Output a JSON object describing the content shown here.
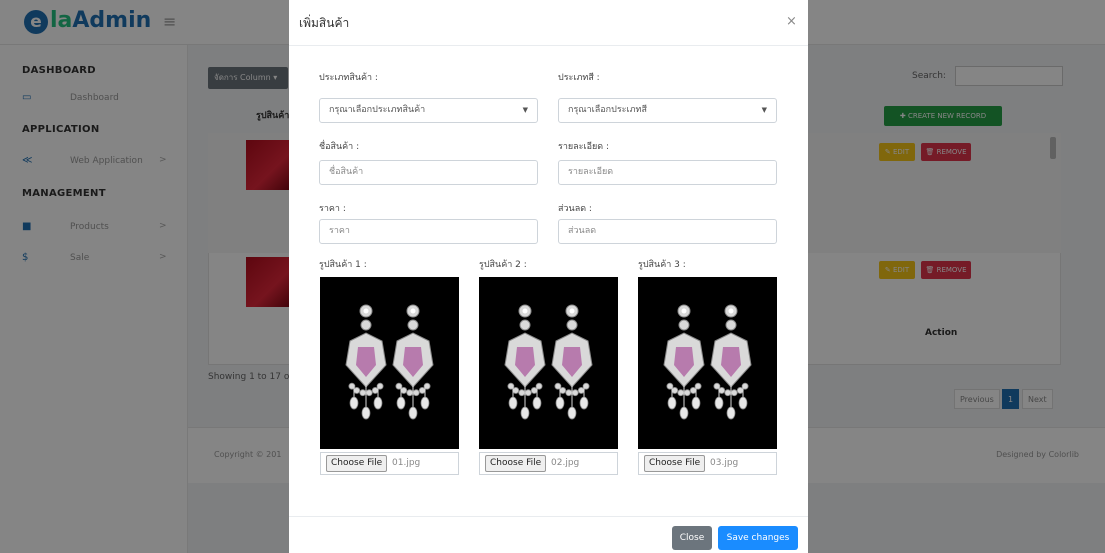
{
  "app": {
    "logo_mark": "e",
    "logo_la": "la",
    "logo_rest": "Admin",
    "menu_icon": "hamburger-icon"
  },
  "sidebar": {
    "sections": [
      {
        "label": "DASHBOARD",
        "items": [
          {
            "label": "Dashboard",
            "icon": "monitor-icon"
          }
        ]
      },
      {
        "label": "APPLICATION",
        "items": [
          {
            "label": "Web Application",
            "icon": "share-icon",
            "chevron": ">"
          }
        ]
      },
      {
        "label": "MANAGEMENT",
        "items": [
          {
            "label": "Products",
            "icon": "box-icon",
            "chevron": ">"
          },
          {
            "label": "Sale",
            "icon": "dollar-icon",
            "chevron": ">"
          }
        ]
      }
    ]
  },
  "content": {
    "column_visibility": "จัดการ Column ▾",
    "search_label": "Search:",
    "table": {
      "image_header": "รูปสินค้า",
      "action_header": "Action",
      "create_button": "✚ CREATE NEW RECORD",
      "edit_button": "✎ EDIT",
      "remove_button": "🗑 REMOVE"
    },
    "showing_text": "Showing 1 to 17 of",
    "pagination": {
      "previous": "Previous",
      "current": "1",
      "next": "Next"
    }
  },
  "footer": {
    "copyright": "Copyright © 201",
    "designed_by": "Designed by Colorlib"
  },
  "modal": {
    "title": "เพิ่มสินค้า",
    "close_icon": "×",
    "fields": {
      "product_type": {
        "label": "ประเภทสินค้า :",
        "value": "กรุณาเลือกประเภทสินค้า"
      },
      "gem_type": {
        "label": "ประเภทสี :",
        "value": "กรุณาเลือกประเภทสี"
      },
      "product_name": {
        "label": "ชื่อสินค้า :",
        "placeholder": "ชื่อสินค้า"
      },
      "detail": {
        "label": "รายละเอียด :",
        "placeholder": "รายละเอียด"
      },
      "price": {
        "label": "ราคา :",
        "placeholder": "ราคา"
      },
      "discount": {
        "label": "ส่วนลด :",
        "placeholder": "ส่วนลด"
      }
    },
    "images": [
      {
        "label": "รูปสินค้า 1 :",
        "button": "Choose File",
        "filename": "01.jpg"
      },
      {
        "label": "รูปสินค้า 2 :",
        "button": "Choose File",
        "filename": "02.jpg"
      },
      {
        "label": "รูปสินค้า 3 :",
        "button": "Choose File",
        "filename": "03.jpg"
      }
    ],
    "buttons": {
      "close": "Close",
      "save": "Save changes"
    }
  }
}
